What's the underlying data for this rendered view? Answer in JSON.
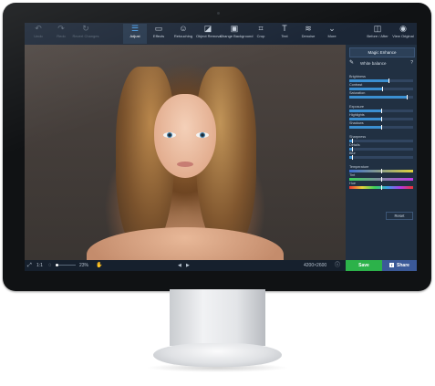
{
  "toolbar": {
    "undo": "Undo",
    "redo": "Redo",
    "revert": "Revert Changes",
    "adjust": "Adjust",
    "effects": "Effects",
    "retouching": "Retouching",
    "object_removal": "Object Removal",
    "change_background": "Change Background",
    "crop": "Crop",
    "text": "Text",
    "denoise": "Denoise",
    "more": "More",
    "before_after": "Before / After",
    "view_original": "View Original"
  },
  "icons": {
    "undo": "↶",
    "redo": "↷",
    "revert": "↻",
    "adjust": "☰",
    "effects": "▭",
    "retouching": "☺",
    "object_removal": "◪",
    "change_background": "▣",
    "crop": "⌗",
    "text": "T",
    "denoise": "≋",
    "more": "⌄",
    "before_after": "◫",
    "view_original": "◉",
    "wand": "✎",
    "help": "?",
    "fullscreen": "⤢",
    "zoom": "◌",
    "pan": "✋",
    "prev": "◀",
    "next": "▶",
    "info": "ⓘ",
    "facebook": "f"
  },
  "panel": {
    "magic_enhance": "Magic Enhance",
    "white_balance": "White balance",
    "help": "?",
    "sliders": [
      {
        "label": "Brightness",
        "value": 0.62
      },
      {
        "label": "Contrast",
        "value": 0.52
      },
      {
        "label": "Saturation",
        "value": 0.92
      },
      {
        "label": "Exposure",
        "value": 0.5
      },
      {
        "label": "Highlights",
        "value": 0.5
      },
      {
        "label": "Shadows",
        "value": 0.5
      },
      {
        "label": "Sharpness",
        "value": 0.05
      },
      {
        "label": "Details",
        "value": 0.05
      },
      {
        "label": "Blur",
        "value": 0.05
      },
      {
        "label": "Temperature",
        "value": 0.5
      },
      {
        "label": "Tint",
        "value": 0.5
      },
      {
        "label": "Hue",
        "value": 0.5
      }
    ],
    "reset": "Reset"
  },
  "bottombar": {
    "fit": "1:1",
    "zoom": "23%",
    "dimensions": "4200×2600"
  },
  "actions": {
    "save": "Save",
    "share": "Share"
  },
  "colors": {
    "accent": "#3b8fd1",
    "save": "#2cb24a",
    "share": "#3b5998"
  }
}
